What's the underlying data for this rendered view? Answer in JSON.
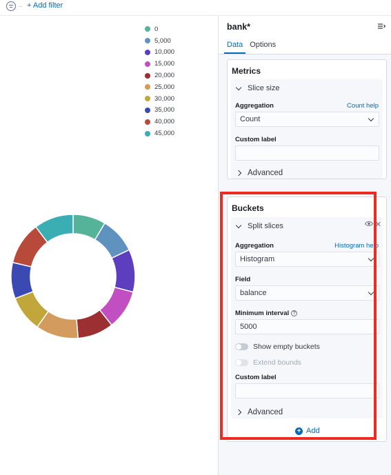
{
  "filter_bar": {
    "add_filter": "+ Add filter",
    "icon": "filter-icon"
  },
  "legend": [
    {
      "label": "0",
      "color": "#54b399"
    },
    {
      "label": "5,000",
      "color": "#6092c0"
    },
    {
      "label": "10,000",
      "color": "#5c3ebf"
    },
    {
      "label": "15,000",
      "color": "#c24fc2"
    },
    {
      "label": "20,000",
      "color": "#9b2f32"
    },
    {
      "label": "25,000",
      "color": "#d39c5e"
    },
    {
      "label": "30,000",
      "color": "#c1a73b"
    },
    {
      "label": "35,000",
      "color": "#3a4ab2"
    },
    {
      "label": "40,000",
      "color": "#b84a3c"
    },
    {
      "label": "45,000",
      "color": "#3aaeb3"
    }
  ],
  "chart_data": {
    "type": "pie",
    "donut": true,
    "categories": [
      "0",
      "5,000",
      "10,000",
      "15,000",
      "20,000",
      "25,000",
      "30,000",
      "35,000",
      "40,000",
      "45,000"
    ],
    "values": [
      10,
      11,
      13,
      12,
      11,
      13,
      11,
      11,
      13,
      12
    ],
    "colors": [
      "#54b399",
      "#6092c0",
      "#5c3ebf",
      "#c24fc2",
      "#9b2f32",
      "#d39c5e",
      "#c1a73b",
      "#3a4ab2",
      "#b84a3c",
      "#3aaeb3"
    ],
    "legend_position": "top-right"
  },
  "sidebar": {
    "index_pattern": "bank*",
    "collapse_icon": "collapse-sidebar-icon",
    "tabs": [
      {
        "label": "Data",
        "active": true
      },
      {
        "label": "Options",
        "active": false
      }
    ],
    "metrics": {
      "title": "Metrics",
      "agg_title": "Slice size",
      "aggregation_label": "Aggregation",
      "help_link": "Count help",
      "aggregation_value": "Count",
      "custom_label": "Custom label",
      "custom_label_value": "",
      "advanced": "Advanced"
    },
    "buckets": {
      "title": "Buckets",
      "agg_title": "Split slices",
      "aggregation_label": "Aggregation",
      "help_link": "Histogram help",
      "aggregation_value": "Histogram",
      "field_label": "Field",
      "field_value": "balance",
      "min_interval_label": "Minimum interval",
      "min_interval_value": "5000",
      "show_empty_buckets": "Show empty buckets",
      "extend_bounds": "Extend bounds",
      "custom_label": "Custom label",
      "custom_label_value": "",
      "advanced": "Advanced",
      "add_button": "Add"
    }
  },
  "highlight_color": "#ee2b1e"
}
